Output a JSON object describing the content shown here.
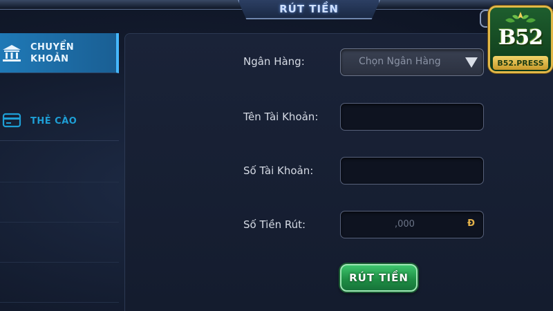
{
  "header": {
    "title": "RÚT TIỀN"
  },
  "sidebar": {
    "items": [
      {
        "label_line1": "CHUYỂN",
        "label_line2": "KHOẢN",
        "icon": "bank-icon",
        "active": true
      },
      {
        "label": "THẺ CÀO",
        "icon": "card-icon",
        "active": false
      }
    ]
  },
  "form": {
    "bank_label": "Ngân Hàng:",
    "bank_placeholder": "Chọn Ngân Hàng",
    "account_name_label": "Tên Tài Khoản:",
    "account_name_value": "",
    "account_number_label": "Số Tài Khoản:",
    "account_number_value": "",
    "amount_label": "Số Tiền Rút:",
    "amount_placeholder": ",000",
    "currency": "Đ",
    "submit_label": "RÚT TIỀN"
  },
  "logo": {
    "main": "B52",
    "sub": "B52.PRESS"
  },
  "colors": {
    "active_tab": "#1f79b6",
    "submit": "#1f8f45",
    "accent_gold": "#e2b848",
    "inactive_tab_text": "#1e9fd6"
  }
}
